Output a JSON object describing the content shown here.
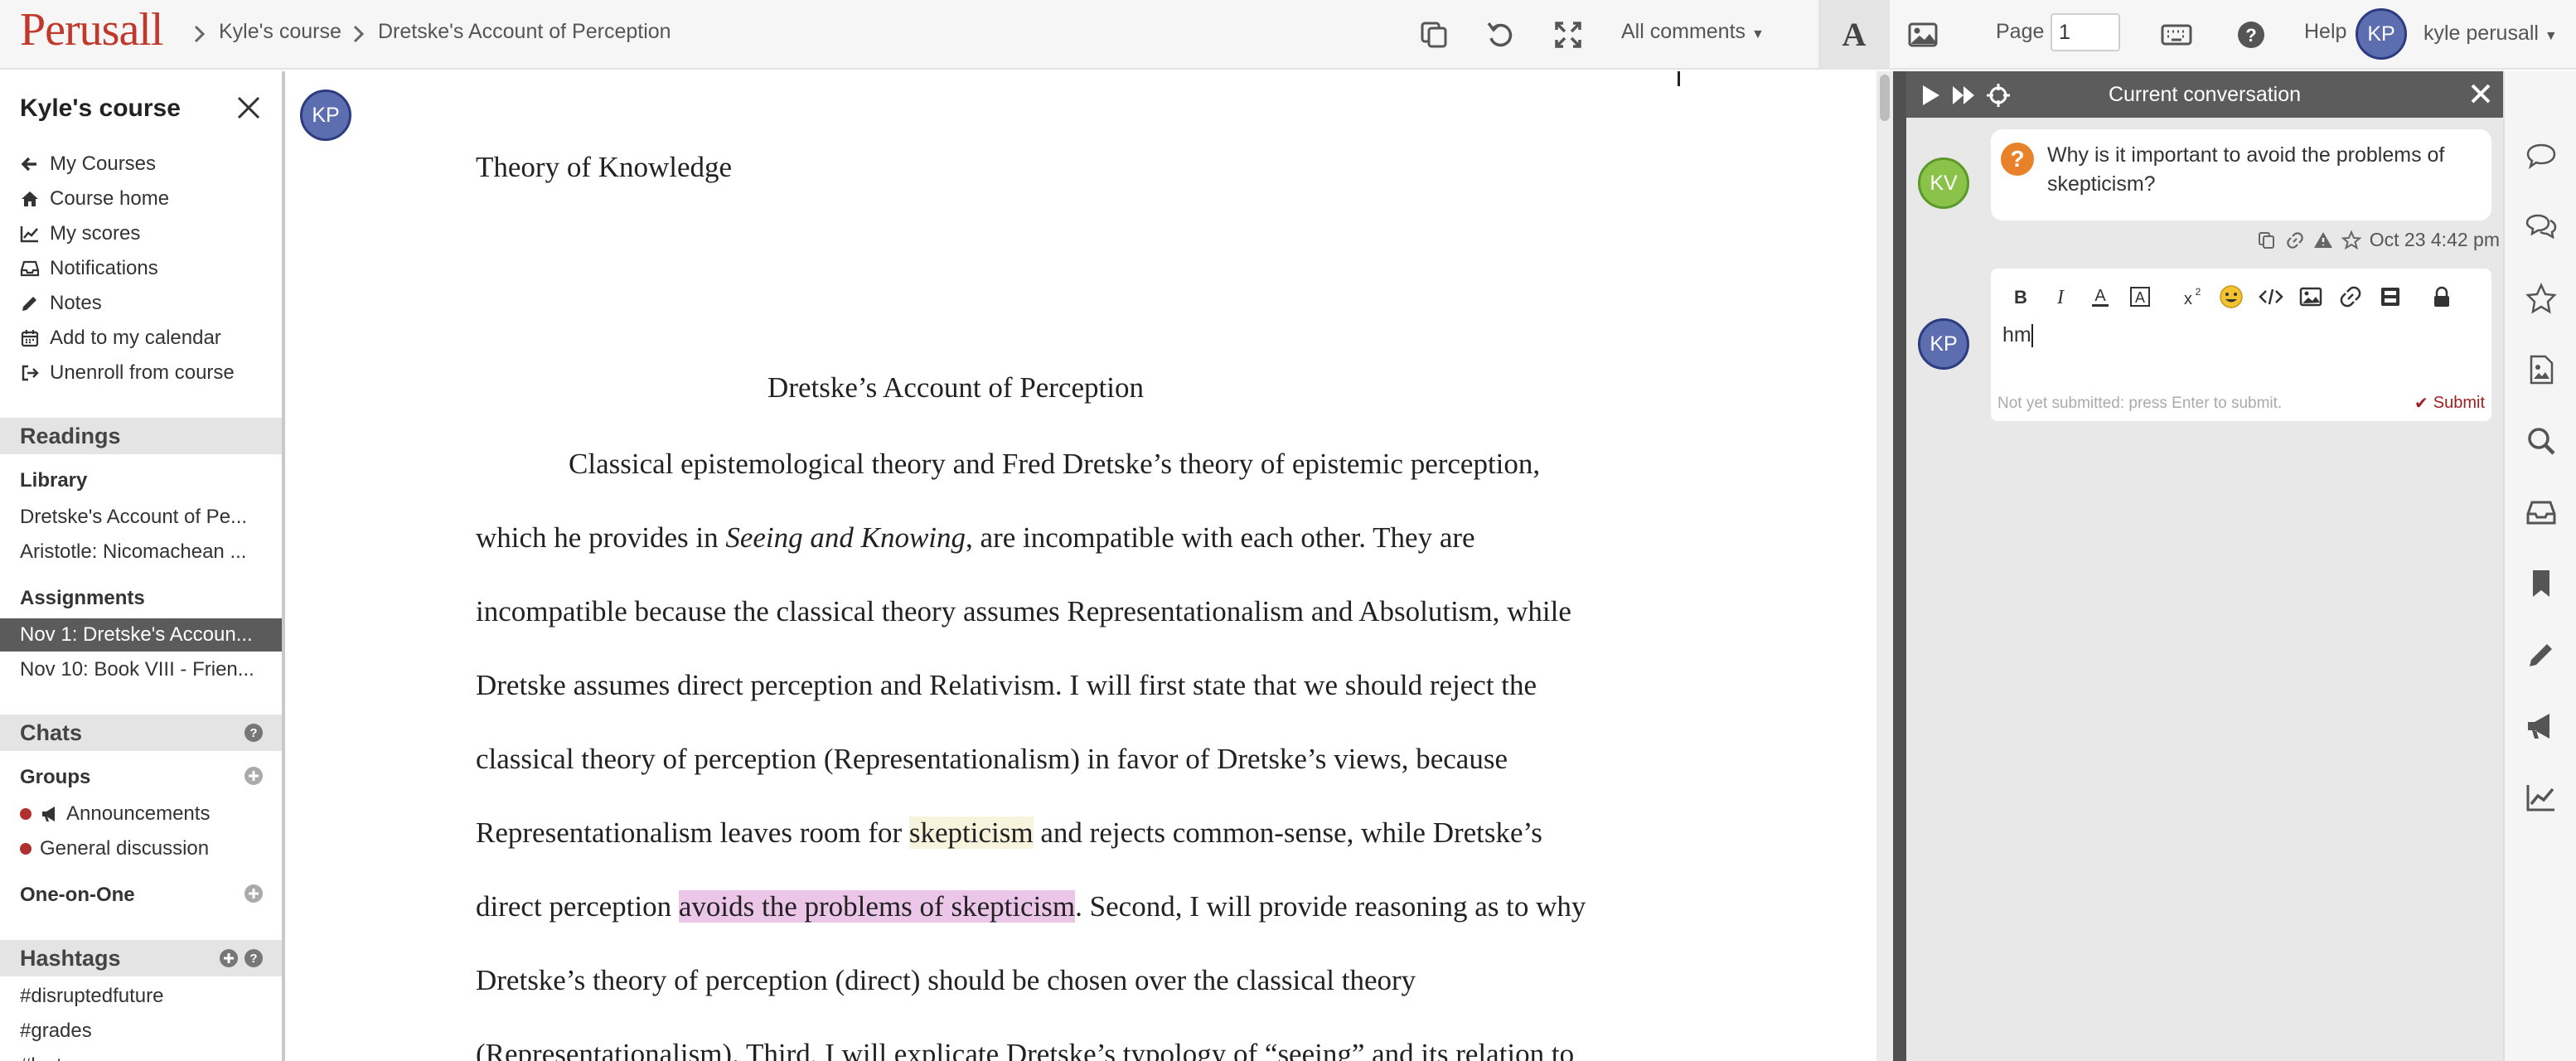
{
  "topbar": {
    "logo": "Perusall",
    "breadcrumb": [
      "Kyle's course",
      "Dretske's Account of Perception"
    ],
    "comments_filter": "All comments",
    "font_button": "A",
    "page_label": "Page",
    "page_value": "1",
    "help_label": "Help",
    "user_initials": "KP",
    "user_name": "kyle perusall"
  },
  "sidebar": {
    "course_title": "Kyle's course",
    "menu": [
      {
        "label": "My Courses",
        "icon": "arrow-left-icon"
      },
      {
        "label": "Course home",
        "icon": "home-icon"
      },
      {
        "label": "My scores",
        "icon": "chart-icon"
      },
      {
        "label": "Notifications",
        "icon": "inbox-icon"
      },
      {
        "label": "Notes",
        "icon": "pencil-icon"
      },
      {
        "label": "Add to my calendar",
        "icon": "calendar-icon"
      },
      {
        "label": "Unenroll from course",
        "icon": "sign-out-icon"
      }
    ],
    "readings_header": "Readings",
    "library_header": "Library",
    "library": [
      "Dretske's Account of Pe...",
      "Aristotle: Nicomachean ..."
    ],
    "assignments_header": "Assignments",
    "assignments": [
      "Nov 1: Dretske's Accoun...",
      "Nov 10: Book VIII - Frien..."
    ],
    "chats_header": "Chats",
    "groups_header": "Groups",
    "groups": [
      "Announcements",
      "General discussion"
    ],
    "one_on_one_header": "One-on-One",
    "hashtags_header": "Hashtags",
    "hashtags": [
      "#disruptedfuture",
      "#grades",
      "#lecture"
    ]
  },
  "document": {
    "avatar_initials": "KP",
    "heading": "Theory of Knowledge",
    "title": "Dretske’s Account of Perception",
    "lines": [
      [
        "Classical epistemological theory and Fred Dretske’s theory of epistemic perception,"
      ],
      [
        "which he provides in ",
        "Seeing and Knowing",
        ", are incompatible with each other. They are"
      ],
      [
        "incompatible because the classical theory assumes Representationalism and Absolutism, while"
      ],
      [
        "Dretske assumes direct perception and Relativism. I will first state that we should reject the"
      ],
      [
        "classical theory of perception (Representationalism) in favor of Dretske’s views, because"
      ],
      [
        "Representationalism leaves room for ",
        "skepticism",
        " and rejects common-sense, while Dretske’s"
      ],
      [
        "direct perception ",
        "avoids the problems of skepticism",
        ". Second, I will provide reasoning as to why"
      ],
      [
        "Dretske’s theory of perception (direct) should be chosen over the classical theory"
      ],
      [
        "(Representationalism). Third, I will explicate Dretske’s typology of “seeing” and its relation to"
      ]
    ]
  },
  "conversation": {
    "title": "Current conversation",
    "question_author_initials": "KV",
    "question_text": "Why is it important to avoid the problems of skepticism?",
    "question_timestamp": "Oct 23 4:42 pm",
    "reply_author_initials": "KP",
    "reply_text": "hm",
    "hint": "Not yet submitted: press Enter to submit.",
    "submit_label": "Submit",
    "toolbar": [
      "bold-icon",
      "italic-icon",
      "font-color-icon",
      "highlight-icon",
      "superscript-icon",
      "emoji-icon",
      "code-icon",
      "image-icon",
      "link-icon",
      "video-icon",
      "lock-icon"
    ]
  },
  "colors": {
    "logo": "#c0392b",
    "highlight_yellow": "#f7f3dc",
    "highlight_pink": "#ebc6e8",
    "question_icon": "#e8822a",
    "submit": "#a02020"
  }
}
